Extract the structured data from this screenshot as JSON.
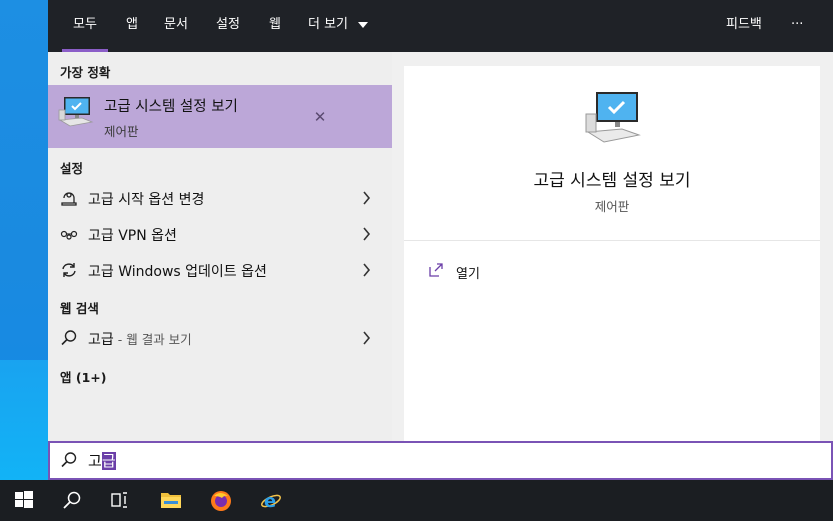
{
  "tabs": [
    "모두",
    "앱",
    "문서",
    "설정",
    "웹"
  ],
  "more_label": "더 보기",
  "feedback_label": "피드백",
  "overflow_label": "···",
  "best_match": {
    "section": "가장 정확",
    "title": "고급 시스템 설정 보기",
    "subtitle": "제어판",
    "close": "✕"
  },
  "settings_section": "설정",
  "settings_items": [
    {
      "label": "고급 시작 옵션 변경",
      "icon": "startup-icon"
    },
    {
      "label": "고급 VPN 옵션",
      "icon": "vpn-icon"
    },
    {
      "label": "고급 Windows 업데이트 옵션",
      "icon": "update-icon"
    }
  ],
  "web_section": "웹 검색",
  "web_item": {
    "query": "고급",
    "suffix": " - 웹 결과 보기"
  },
  "apps_section": "앱 (1+)",
  "detail": {
    "title": "고급 시스템 설정 보기",
    "subtitle": "제어판",
    "open_label": "열기"
  },
  "search": {
    "query_prefix": "고",
    "query_selected": "급"
  },
  "taskbar": [
    "windows-start-icon",
    "search-icon",
    "task-view-icon",
    "file-explorer-icon",
    "firefox-icon",
    "internet-explorer-icon"
  ],
  "colors": {
    "accent": "#8b5ec8",
    "highlight": "#bca7d8",
    "topbar": "#1f2227",
    "taskbar": "#1b1e22"
  }
}
